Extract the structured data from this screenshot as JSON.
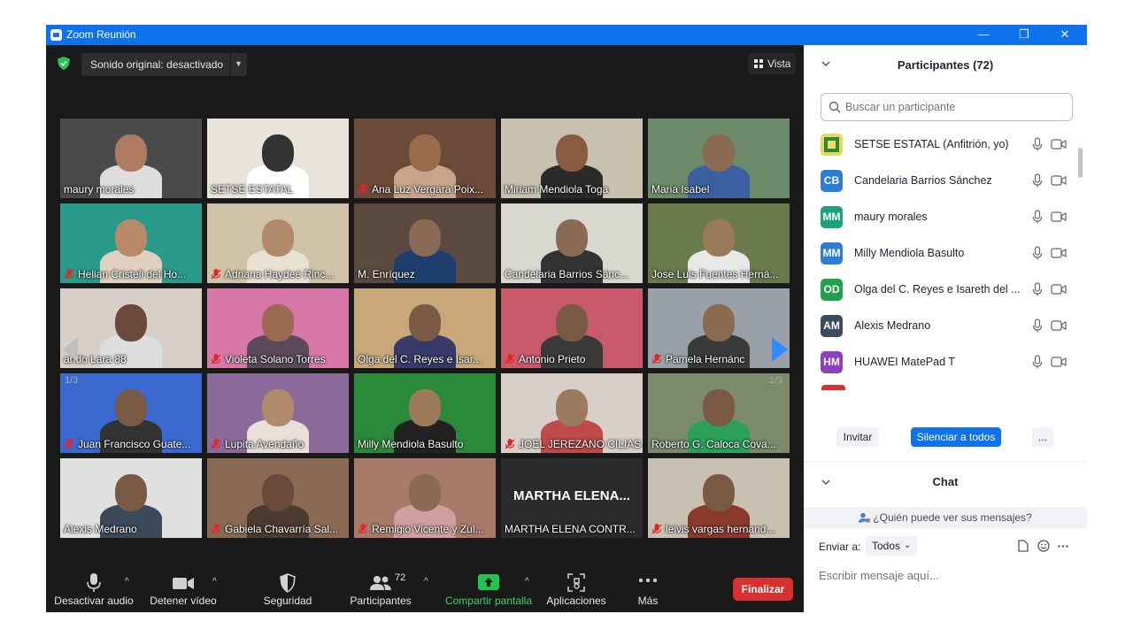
{
  "window": {
    "title": "Zoom Reunión",
    "minimize": "—",
    "restore": "❐",
    "close": "✕"
  },
  "top": {
    "sound_label": "Sonido original: desactivado",
    "view_label": "Vista"
  },
  "pager": {
    "left": "1/3",
    "right": "1/3"
  },
  "tiles": [
    {
      "name": "maury morales",
      "muted": false
    },
    {
      "name": "SETSE ESTATAL",
      "muted": false
    },
    {
      "name": "Ana Luz Vergara Poix...",
      "muted": true
    },
    {
      "name": "Miriam Mendiola Toga",
      "muted": false
    },
    {
      "name": "Maria Isabel",
      "muted": false
    },
    {
      "name": "Helian Cristell del Ho...",
      "muted": true
    },
    {
      "name": "Adriana Haydeé Rinc...",
      "muted": true
    },
    {
      "name": "M. Enríquez",
      "muted": false
    },
    {
      "name": "Candelaria Barrios Sánc...",
      "muted": false
    },
    {
      "name": "Jose Luis Fuentes Herná...",
      "muted": false
    },
    {
      "name": "ando Lara 88",
      "muted": false
    },
    {
      "name": "Violeta Solano Torres",
      "muted": true
    },
    {
      "name": "Olga del C. Reyes e Isar...",
      "muted": false
    },
    {
      "name": "Antonio Prieto",
      "muted": true
    },
    {
      "name": "Pamela Hernánc",
      "muted": true
    },
    {
      "name": "Juan Francisco Guate...",
      "muted": true
    },
    {
      "name": "Lupita Avendaño",
      "muted": true
    },
    {
      "name": "Milly Mendiola Basulto",
      "muted": false
    },
    {
      "name": "JOEL JEREZANO CILIAS",
      "muted": true
    },
    {
      "name": "Roberto G. Caloca Cova...",
      "muted": false
    },
    {
      "name": "Alexis Medrano",
      "muted": false
    },
    {
      "name": "Gabiela Chavarría Sal...",
      "muted": true
    },
    {
      "name": "Remigio Vicente y Zul...",
      "muted": true
    },
    {
      "name": "MARTHA ELENA CONTR...",
      "muted": false,
      "placeholder": "MARTHA ELENA..."
    },
    {
      "name": "leivis vargas hernand...",
      "muted": true
    }
  ],
  "toolbar": {
    "audio": "Desactivar audio",
    "video": "Detener vídeo",
    "security": "Seguridad",
    "participants": "Participantes",
    "participants_count": "72",
    "share": "Compartir pantalla",
    "apps": "Aplicaciones",
    "more": "Más",
    "end": "Finalizar"
  },
  "panel": {
    "title": "Participantes (72)",
    "search_placeholder": "Buscar un participante",
    "participants": [
      {
        "initials": "",
        "name": "SETSE ESTATAL (Anfitrión, yo)",
        "color": "#e8d85a"
      },
      {
        "initials": "CB",
        "name": "Candelaria Barrios Sánchez",
        "color": "#2d7dd2"
      },
      {
        "initials": "MM",
        "name": "maury morales",
        "color": "#1aa37a"
      },
      {
        "initials": "MM",
        "name": "Milly Mendiola Basulto",
        "color": "#2d7dd2"
      },
      {
        "initials": "OD",
        "name": "Olga del C. Reyes e Isareth del ...",
        "color": "#22a04b"
      },
      {
        "initials": "AM",
        "name": "Alexis Medrano",
        "color": "#3c4a5e"
      },
      {
        "initials": "HM",
        "name": "HUAWEI MatePad T",
        "color": "#8e3fbf"
      }
    ],
    "invite": "Invitar",
    "mute_all": "Silenciar a todos",
    "more": "...",
    "chat_title": "Chat",
    "who_can_see": "¿Quién puede ver sus mensajes?",
    "send_to": "Enviar a:",
    "send_to_value": "Todos",
    "message_placeholder": "Escribir mensaje aquí..."
  }
}
